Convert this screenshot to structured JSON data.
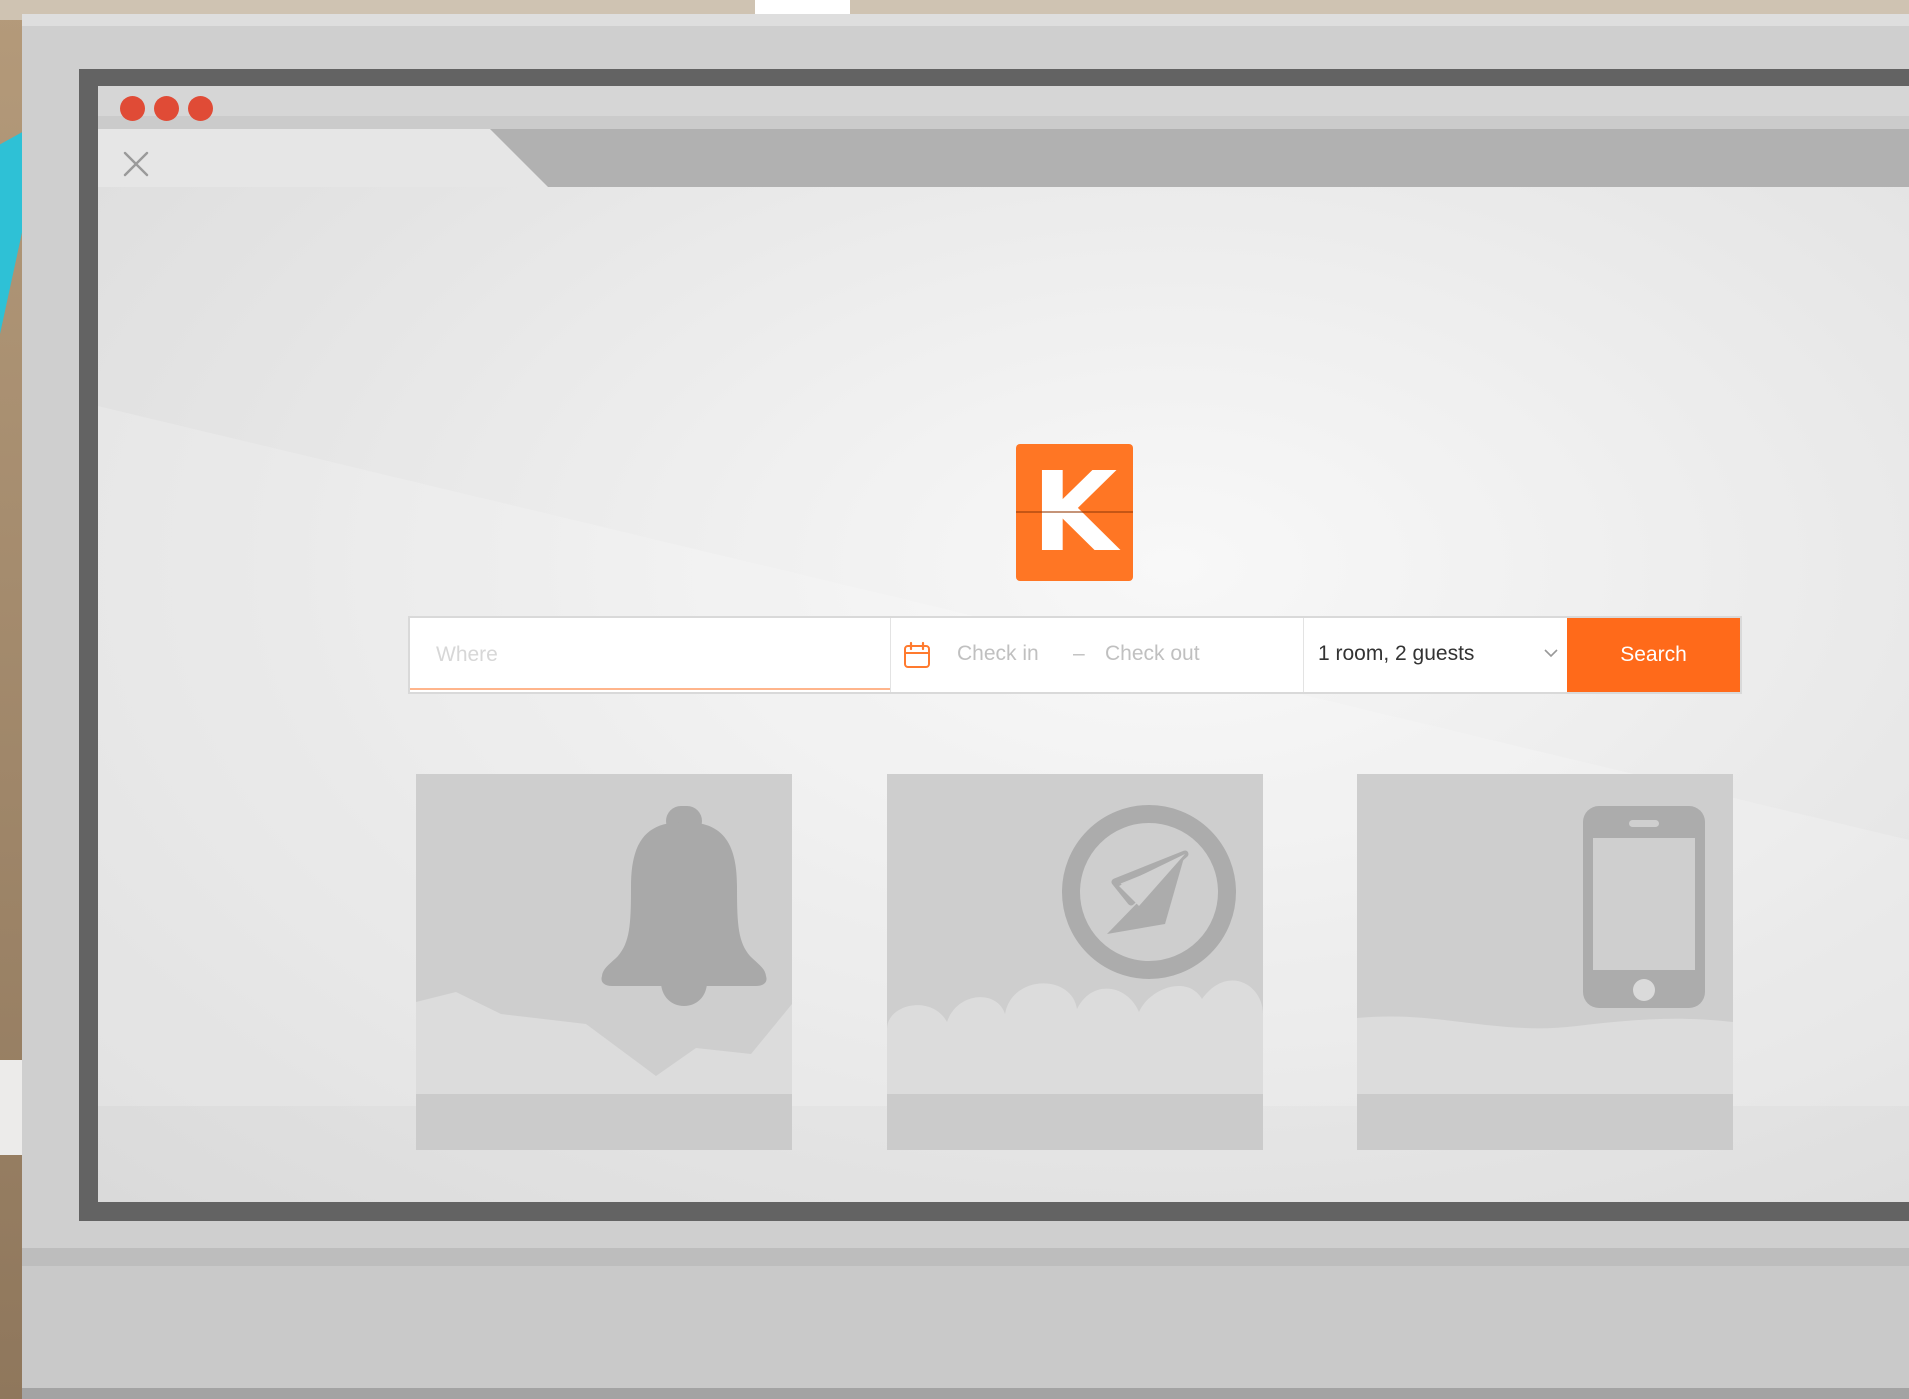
{
  "window": {
    "controls": [
      "close-dot",
      "minimize-dot",
      "maximize-dot"
    ],
    "control_color": "#e04b36"
  },
  "brand": {
    "logo_letter": "K",
    "accent_color": "#ff7624"
  },
  "search": {
    "where_placeholder": "Where",
    "checkin_label": "Check in",
    "dash": "–",
    "checkout_label": "Check out",
    "guests_value": "1 room, 2 guests",
    "button_label": "Search",
    "button_color": "#ff6a1a"
  },
  "cards": [
    {
      "icon": "bell-icon"
    },
    {
      "icon": "compass-icon"
    },
    {
      "icon": "smartphone-icon"
    }
  ]
}
